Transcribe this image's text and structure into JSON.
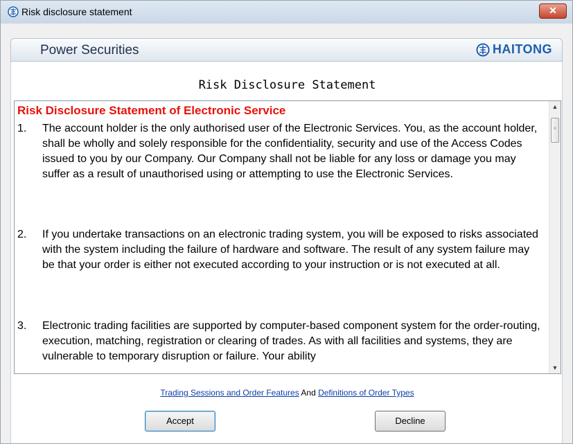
{
  "window": {
    "title": "Risk disclosure statement",
    "close_label": "✕"
  },
  "brand": {
    "app_name": "Power Securities",
    "logo_text": "HAITONG"
  },
  "document": {
    "heading": "Risk Disclosure Statement",
    "title": "Risk Disclosure Statement of Electronic Service",
    "items": [
      {
        "number": "1.",
        "text": "The account holder is the only authorised user of the Electronic Services. You, as the account holder, shall be wholly and solely responsible for the confidentiality, security and use of the Access Codes issued to you by our Company. Our Company shall not be liable for any loss or damage you may suffer as a result of unauthorised using or attempting to use the Electronic Services."
      },
      {
        "number": "2.",
        "text": "If you undertake transactions on an electronic trading system, you will be exposed to risks associated with the system including the failure of hardware and software. The result of any system failure may be that your order is either not executed according to your instruction or is not executed at all."
      },
      {
        "number": "3.",
        "text": "Electronic trading facilities are supported by computer-based component system for the order-routing, execution, matching, registration or clearing of trades. As with all facilities and systems, they are vulnerable to temporary disruption or failure. Your ability"
      }
    ]
  },
  "footer": {
    "link_sessions": "Trading Sessions and Order Features",
    "connector": "And",
    "link_order_types": "Definitions of Order Types",
    "accept_label": "Accept",
    "decline_label": "Decline"
  },
  "colors": {
    "title_red": "#e8120a",
    "link_blue": "#0b3da8",
    "logo_blue": "#1f5fae"
  }
}
